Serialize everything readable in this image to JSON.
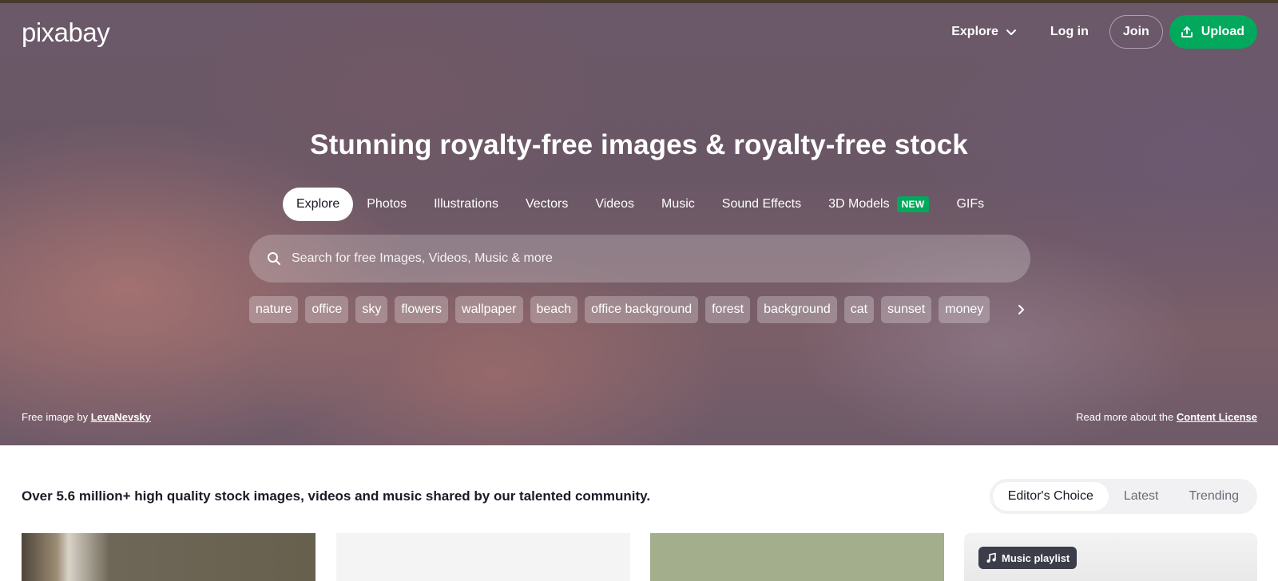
{
  "header": {
    "logo_text": "pixabay",
    "explore_label": "Explore",
    "login_label": "Log in",
    "join_label": "Join",
    "upload_label": "Upload",
    "upload_color": "#02a95c"
  },
  "hero": {
    "headline": "Stunning royalty-free images & royalty-free stock",
    "tabs": [
      {
        "label": "Explore",
        "active": true
      },
      {
        "label": "Photos"
      },
      {
        "label": "Illustrations"
      },
      {
        "label": "Vectors"
      },
      {
        "label": "Videos"
      },
      {
        "label": "Music"
      },
      {
        "label": "Sound Effects"
      },
      {
        "label": "3D Models",
        "badge": "NEW"
      },
      {
        "label": "GIFs"
      }
    ],
    "search_placeholder": "Search for free Images, Videos, Music & more",
    "chips": [
      "nature",
      "office",
      "sky",
      "flowers",
      "wallpaper",
      "beach",
      "office background",
      "forest",
      "background",
      "cat",
      "sunset",
      "money"
    ],
    "credit_prefix": "Free image by",
    "credit_author": "LevaNevsky",
    "license_prefix": "Read more about the",
    "license_link": "Content License"
  },
  "main": {
    "intro_text": "Over 5.6 million+ high quality stock images, videos and music shared by our talented community.",
    "sort_options": [
      {
        "label": "Editor's Choice",
        "active": true
      },
      {
        "label": "Latest"
      },
      {
        "label": "Trending"
      }
    ],
    "music_playlist_label": "Music playlist"
  }
}
